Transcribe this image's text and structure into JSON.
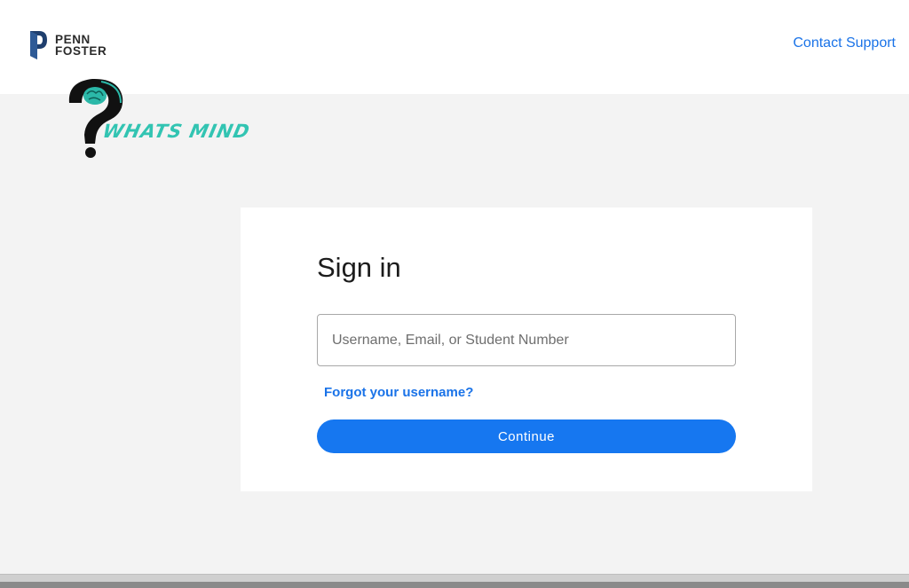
{
  "header": {
    "brand_line1": "PENN",
    "brand_line2": "FOSTER",
    "contact_support": "Contact Support",
    "brand_color": "#1f3f6e",
    "link_color": "#1a73e8"
  },
  "watermark": {
    "text": "WHATS MIND",
    "ring_text": "WHAT'S MIND",
    "accent_color": "#32c4b2",
    "icon": "question-head-icon"
  },
  "signin": {
    "title": "Sign in",
    "username_placeholder": "Username, Email, or Student Number",
    "username_value": "",
    "forgot_link": "Forgot your username?",
    "continue_label": "Continue",
    "button_color": "#1677f0"
  }
}
